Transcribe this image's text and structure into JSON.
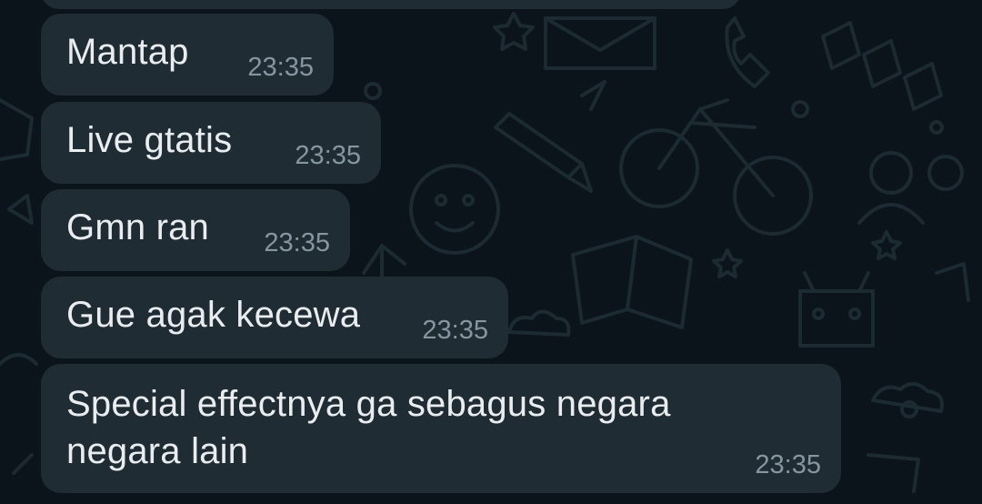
{
  "chat": {
    "messages": [
      {
        "text": "Mantap",
        "time": "23:35"
      },
      {
        "text": "Live gtatis",
        "time": "23:35"
      },
      {
        "text": "Gmn ran",
        "time": "23:35"
      },
      {
        "text": "Gue agak kecewa",
        "time": "23:35"
      },
      {
        "text": "Special effectnya ga sebagus negara negara lain",
        "time": "23:35"
      }
    ]
  },
  "colors": {
    "background": "#0b141a",
    "bubble": "#1f2c34",
    "text": "#e9edef",
    "timestamp": "#8696a0",
    "doodle": "#1c2a31"
  }
}
